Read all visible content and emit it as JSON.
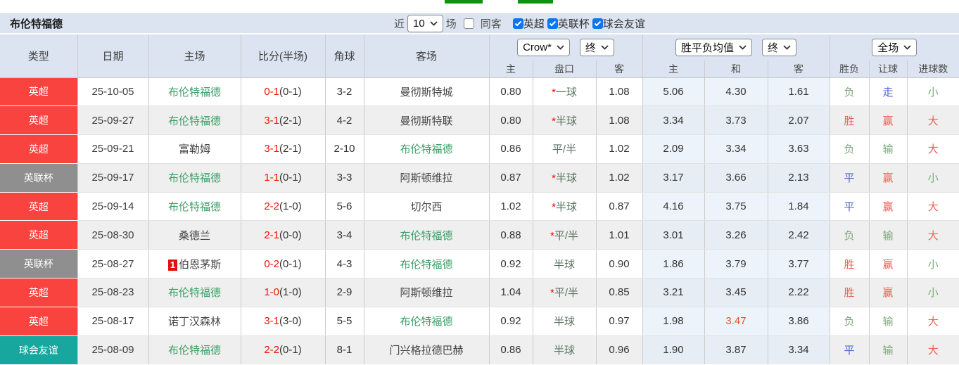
{
  "title": "布伦特福德",
  "filters": {
    "recent_label": "近",
    "recent_count": "10",
    "matches_label": "场",
    "same_away_label": "同客",
    "same_away_checked": false,
    "competitions": [
      {
        "label": "英超",
        "checked": true
      },
      {
        "label": "英联杯",
        "checked": true
      },
      {
        "label": "球会友谊",
        "checked": true
      }
    ]
  },
  "header": {
    "static_columns": [
      "类型",
      "日期",
      "主场",
      "比分(半场)",
      "角球",
      "客场"
    ],
    "odds_company_select": "Crow*",
    "odds_stage_select": "终",
    "avg_type_select": "胜平负均值",
    "avg_stage_select": "终",
    "scope_select": "全场",
    "odds_sub_columns": [
      "主",
      "盘口",
      "客"
    ],
    "avg_sub_columns": [
      "主",
      "和",
      "客"
    ],
    "result_sub_columns": [
      "胜负",
      "让球",
      "进球数"
    ]
  },
  "colors": {
    "green_bar": "#0c940c",
    "header_bg": "#dbe4f0",
    "row_alt_bg": "#efefef",
    "avg_col_bg": "#edf3fa",
    "avg_col_alt_bg": "#e7edf4",
    "league": {
      "epl": "#f8433f",
      "league_cup": "#8f8f8f",
      "friendly": "#17a79e"
    },
    "team_highlight": "#3d9f68",
    "team_normal": "#454545",
    "score_ft": "#ee1100",
    "score_ht": "#333333",
    "handicap_star": "#ff0000",
    "handicap_text": "#5a7360",
    "avg_highlight": "#e8502d",
    "red_card_bg": "#e11010",
    "result": {
      "r": "#ef6157",
      "g": "#7ca87c",
      "b": "#5166d2"
    }
  },
  "rows": [
    {
      "league": "英超",
      "league_type": "epl",
      "date": "25-10-05",
      "home": "布伦特福德",
      "home_active": true,
      "home_red_card": "",
      "score_ft": "0-1",
      "score_ht": "(0-1)",
      "corners": "3-2",
      "away": "曼彻斯特城",
      "away_active": false,
      "odds_home": "0.80",
      "handicap_star": true,
      "handicap": "一球",
      "odds_away": "1.08",
      "avg_home": "5.06",
      "avg_draw": "4.30",
      "avg_draw_highlight": false,
      "avg_away": "1.61",
      "result": "负",
      "result_c": "g",
      "handicap_result": "走",
      "handicap_result_c": "b",
      "goals": "小",
      "goals_c": "g"
    },
    {
      "league": "英超",
      "league_type": "epl",
      "date": "25-09-27",
      "home": "布伦特福德",
      "home_active": true,
      "home_red_card": "",
      "score_ft": "3-1",
      "score_ht": "(2-1)",
      "corners": "4-2",
      "away": "曼彻斯特联",
      "away_active": false,
      "odds_home": "0.80",
      "handicap_star": true,
      "handicap": "半球",
      "odds_away": "1.08",
      "avg_home": "3.34",
      "avg_draw": "3.73",
      "avg_draw_highlight": false,
      "avg_away": "2.07",
      "result": "胜",
      "result_c": "r",
      "handicap_result": "赢",
      "handicap_result_c": "r",
      "goals": "大",
      "goals_c": "r"
    },
    {
      "league": "英超",
      "league_type": "epl",
      "date": "25-09-21",
      "home": "富勒姆",
      "home_active": false,
      "home_red_card": "",
      "score_ft": "3-1",
      "score_ht": "(2-1)",
      "corners": "2-10",
      "away": "布伦特福德",
      "away_active": true,
      "odds_home": "0.86",
      "handicap_star": false,
      "handicap": "平/半",
      "odds_away": "1.02",
      "avg_home": "2.09",
      "avg_draw": "3.34",
      "avg_draw_highlight": false,
      "avg_away": "3.63",
      "result": "负",
      "result_c": "g",
      "handicap_result": "输",
      "handicap_result_c": "g",
      "goals": "大",
      "goals_c": "r"
    },
    {
      "league": "英联杯",
      "league_type": "league_cup",
      "date": "25-09-17",
      "home": "布伦特福德",
      "home_active": true,
      "home_red_card": "",
      "score_ft": "1-1",
      "score_ht": "(0-1)",
      "corners": "3-3",
      "away": "阿斯顿维拉",
      "away_active": false,
      "odds_home": "0.87",
      "handicap_star": true,
      "handicap": "半球",
      "odds_away": "1.02",
      "avg_home": "3.17",
      "avg_draw": "3.66",
      "avg_draw_highlight": false,
      "avg_away": "2.13",
      "result": "平",
      "result_c": "b",
      "handicap_result": "赢",
      "handicap_result_c": "r",
      "goals": "小",
      "goals_c": "g"
    },
    {
      "league": "英超",
      "league_type": "epl",
      "date": "25-09-14",
      "home": "布伦特福德",
      "home_active": true,
      "home_red_card": "",
      "score_ft": "2-2",
      "score_ht": "(1-0)",
      "corners": "5-6",
      "away": "切尔西",
      "away_active": false,
      "odds_home": "1.02",
      "handicap_star": true,
      "handicap": "半球",
      "odds_away": "0.87",
      "avg_home": "4.16",
      "avg_draw": "3.75",
      "avg_draw_highlight": false,
      "avg_away": "1.84",
      "result": "平",
      "result_c": "b",
      "handicap_result": "赢",
      "handicap_result_c": "r",
      "goals": "大",
      "goals_c": "r"
    },
    {
      "league": "英超",
      "league_type": "epl",
      "date": "25-08-30",
      "home": "桑德兰",
      "home_active": false,
      "home_red_card": "",
      "score_ft": "2-1",
      "score_ht": "(0-0)",
      "corners": "3-4",
      "away": "布伦特福德",
      "away_active": true,
      "odds_home": "0.88",
      "handicap_star": true,
      "handicap": "平/半",
      "odds_away": "1.01",
      "avg_home": "3.01",
      "avg_draw": "3.26",
      "avg_draw_highlight": false,
      "avg_away": "2.42",
      "result": "负",
      "result_c": "g",
      "handicap_result": "输",
      "handicap_result_c": "g",
      "goals": "大",
      "goals_c": "r"
    },
    {
      "league": "英联杯",
      "league_type": "league_cup",
      "date": "25-08-27",
      "home": "伯恩茅斯",
      "home_active": false,
      "home_red_card": "1",
      "score_ft": "0-2",
      "score_ht": "(0-1)",
      "corners": "4-3",
      "away": "布伦特福德",
      "away_active": true,
      "odds_home": "0.92",
      "handicap_star": false,
      "handicap": "半球",
      "odds_away": "0.90",
      "avg_home": "1.86",
      "avg_draw": "3.79",
      "avg_draw_highlight": false,
      "avg_away": "3.77",
      "result": "胜",
      "result_c": "r",
      "handicap_result": "赢",
      "handicap_result_c": "r",
      "goals": "小",
      "goals_c": "g"
    },
    {
      "league": "英超",
      "league_type": "epl",
      "date": "25-08-23",
      "home": "布伦特福德",
      "home_active": true,
      "home_red_card": "",
      "score_ft": "1-0",
      "score_ht": "(1-0)",
      "corners": "2-9",
      "away": "阿斯顿维拉",
      "away_active": false,
      "odds_home": "1.04",
      "handicap_star": true,
      "handicap": "平/半",
      "odds_away": "0.85",
      "avg_home": "3.21",
      "avg_draw": "3.45",
      "avg_draw_highlight": false,
      "avg_away": "2.22",
      "result": "胜",
      "result_c": "r",
      "handicap_result": "赢",
      "handicap_result_c": "r",
      "goals": "小",
      "goals_c": "g"
    },
    {
      "league": "英超",
      "league_type": "epl",
      "date": "25-08-17",
      "home": "诺丁汉森林",
      "home_active": false,
      "home_red_card": "",
      "score_ft": "3-1",
      "score_ht": "(3-0)",
      "corners": "5-5",
      "away": "布伦特福德",
      "away_active": true,
      "odds_home": "0.92",
      "handicap_star": false,
      "handicap": "半球",
      "odds_away": "0.97",
      "avg_home": "1.98",
      "avg_draw": "3.47",
      "avg_draw_highlight": true,
      "avg_away": "3.86",
      "result": "负",
      "result_c": "g",
      "handicap_result": "输",
      "handicap_result_c": "g",
      "goals": "大",
      "goals_c": "r"
    },
    {
      "league": "球会友谊",
      "league_type": "friendly",
      "date": "25-08-09",
      "home": "布伦特福德",
      "home_active": true,
      "home_red_card": "",
      "score_ft": "2-2",
      "score_ht": "(0-1)",
      "corners": "8-1",
      "away": "门兴格拉德巴赫",
      "away_active": false,
      "odds_home": "0.86",
      "handicap_star": false,
      "handicap": "半球",
      "odds_away": "0.96",
      "avg_home": "1.90",
      "avg_draw": "3.87",
      "avg_draw_highlight": false,
      "avg_away": "3.34",
      "result": "平",
      "result_c": "b",
      "handicap_result": "输",
      "handicap_result_c": "g",
      "goals": "大",
      "goals_c": "r"
    }
  ]
}
